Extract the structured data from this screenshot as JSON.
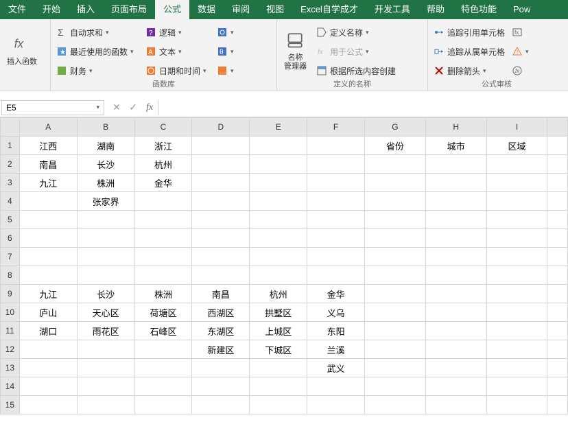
{
  "menu": {
    "tabs": [
      "文件",
      "开始",
      "插入",
      "页面布局",
      "公式",
      "数据",
      "审阅",
      "视图",
      "Excel自学成才",
      "开发工具",
      "帮助",
      "特色功能",
      "Pow"
    ],
    "active_index": 4
  },
  "ribbon": {
    "group1": {
      "insert_fn": "插入函数"
    },
    "group2": {
      "title": "函数库",
      "autosum": "自动求和",
      "recent": "最近使用的函数",
      "finance": "财务",
      "logical": "逻辑",
      "text": "文本",
      "datetime": "日期和时间"
    },
    "group3": {
      "title": "定义的名称",
      "name_mgr": "名称\n管理器",
      "define_name": "定义名称",
      "use_in_formula": "用于公式",
      "create_from_sel": "根据所选内容创建"
    },
    "group4": {
      "title": "公式审核",
      "trace_prec": "追踪引用单元格",
      "trace_dep": "追踪从属单元格",
      "remove_arrows": "删除箭头"
    }
  },
  "formula_bar": {
    "name_box": "E5",
    "formula": ""
  },
  "columns": [
    "A",
    "B",
    "C",
    "D",
    "E",
    "F",
    "G",
    "H",
    "I"
  ],
  "cells": {
    "r1": {
      "A": "江西",
      "B": "湖南",
      "C": "浙江",
      "G": "省份",
      "H": "城市",
      "I": "区域"
    },
    "r2": {
      "A": "南昌",
      "B": "长沙",
      "C": "杭州"
    },
    "r3": {
      "A": "九江",
      "B": "株洲",
      "C": "金华"
    },
    "r4": {
      "B": "张家界"
    },
    "r9": {
      "A": "九江",
      "B": "长沙",
      "C": "株洲",
      "D": "南昌",
      "E": "杭州",
      "F": "金华"
    },
    "r10": {
      "A": "庐山",
      "B": "天心区",
      "C": "荷塘区",
      "D": "西湖区",
      "E": "拱墅区",
      "F": "义乌"
    },
    "r11": {
      "A": "湖口",
      "B": "雨花区",
      "C": "石峰区",
      "D": "东湖区",
      "E": "上城区",
      "F": "东阳"
    },
    "r12": {
      "D": "新建区",
      "E": "下城区",
      "F": "兰溪"
    },
    "r13": {
      "F": "武义"
    }
  }
}
